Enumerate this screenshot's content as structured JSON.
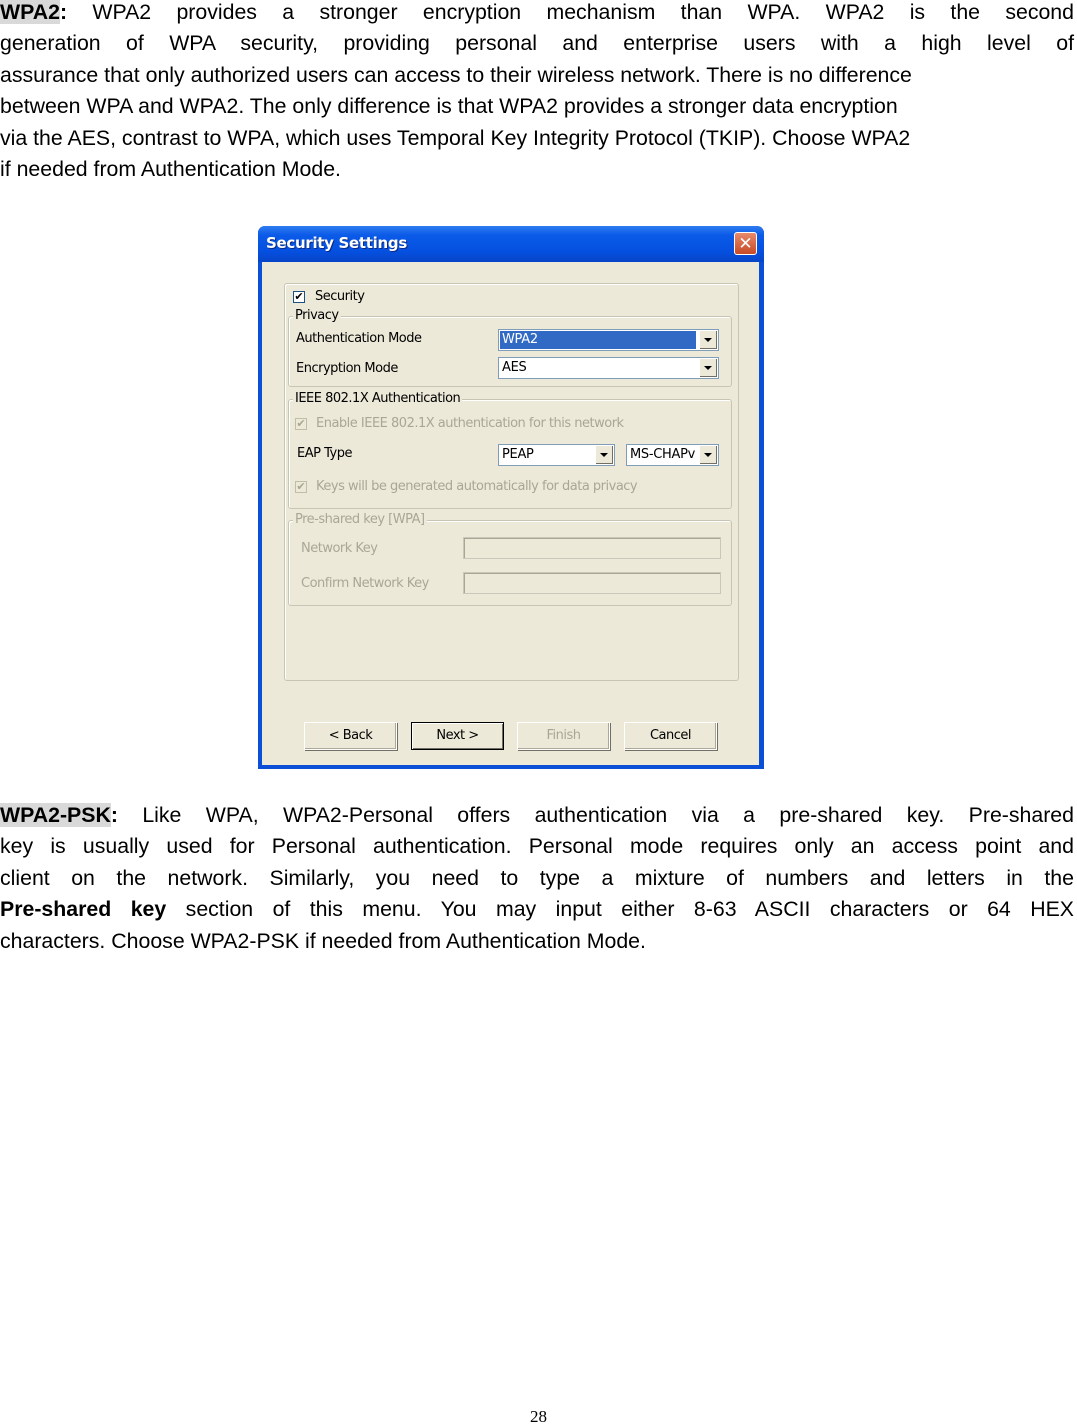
{
  "document": {
    "section1": {
      "term": "WPA2",
      "term_suffix": ":",
      "lines": [
        " WPA2 provides a stronger encryption mechanism than WPA. WPA2 is the second",
        "generation of WPA security, providing personal and enterprise users with a high level of",
        "assurance that only authorized users can access to their wireless network. There is no difference",
        "between WPA and WPA2. The only difference is that WPA2 provides a stronger data encryption",
        "via the AES, contrast to WPA, which uses Temporal Key Integrity Protocol (TKIP). Choose WPA2",
        "if needed from Authentication Mode."
      ]
    },
    "section2": {
      "term": "WPA2-PSK",
      "term_suffix": ":",
      "lines": [
        " Like WPA, WPA2-Personal offers authentication via a pre-shared key. Pre-shared",
        "key is usually used for Personal authentication. Personal mode requires only an access point and",
        "client on the network. Similarly, you need to type a mixture of numbers and letters in the"
      ],
      "line4_bold": "Pre-shared key",
      "line4_rest": " section of this menu. You may input either 8-63 ASCII characters or 64 HEX",
      "line5": "characters. Choose WPA2-PSK if needed from Authentication Mode."
    },
    "page_number": "28"
  },
  "dialog": {
    "title": "Security Settings",
    "close_icon": "close-icon",
    "security_checkbox": {
      "label": "Security",
      "checked": true,
      "mark": "✔"
    },
    "privacy": {
      "legend": "Privacy",
      "auth_mode_label": "Authentication Mode",
      "auth_mode_value": "WPA2",
      "encryption_mode_label": "Encryption Mode",
      "encryption_mode_value": "AES"
    },
    "ieee": {
      "legend": "IEEE 802.1X Authentication",
      "enable_label": "Enable IEEE 802.1X authentication for this network",
      "enable_checked": true,
      "eap_type_label": "EAP Type",
      "eap_type_value": "PEAP",
      "eap_inner_value": "MS-CHAPv",
      "keys_label": "Keys will be generated automatically for data privacy",
      "keys_checked": true,
      "mark": "✔"
    },
    "psk": {
      "legend": "Pre-shared key [WPA]",
      "network_key_label": "Network Key",
      "network_key_value": "",
      "confirm_key_label": "Confirm Network Key",
      "confirm_key_value": ""
    },
    "buttons": {
      "back": "< Back",
      "next": "Next >",
      "finish": "Finish",
      "cancel": "Cancel"
    },
    "colors": {
      "title_bar": "#0550e0",
      "client_bg": "#ece9d8",
      "selection": "#316ac5",
      "disabled_text": "#a9a794"
    }
  }
}
